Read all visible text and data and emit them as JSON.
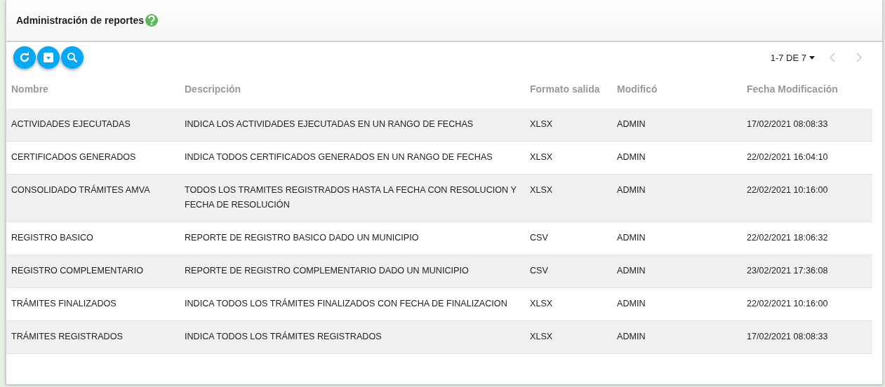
{
  "title": "Administración de reportes",
  "pagination": {
    "range": "1-7 DE 7",
    "prev_disabled": true,
    "next_disabled": true
  },
  "table": {
    "columns": [
      "Nombre",
      "Descripción",
      "Formato salida",
      "Modificó",
      "Fecha Modificación"
    ],
    "rows": [
      [
        "ACTIVIDADES EJECUTADAS",
        "INDICA LOS ACTIVIDADES EJECUTADAS EN UN RANGO DE FECHAS",
        "XLSX",
        "ADMIN",
        "17/02/2021 08:08:33"
      ],
      [
        "CERTIFICADOS GENERADOS",
        "INDICA TODOS CERTIFICADOS GENERADOS EN UN RANGO DE FECHAS",
        "XLSX",
        "ADMIN",
        "22/02/2021 16:04:10"
      ],
      [
        "CONSOLIDADO TRÁMITES AMVA",
        "TODOS LOS TRAMITES REGISTRADOS HASTA LA FECHA CON RESOLUCION Y FECHA DE RESOLUCIÓN",
        "XLSX",
        "ADMIN",
        "22/02/2021 10:16:00"
      ],
      [
        "REGISTRO BASICO",
        "REPORTE DE REGISTRO BASICO DADO UN MUNICIPIO",
        "CSV",
        "ADMIN",
        "22/02/2021 18:06:32"
      ],
      [
        "REGISTRO COMPLEMENTARIO",
        "REPORTE DE REGISTRO COMPLEMENTARIO DADO UN MUNICIPIO",
        "CSV",
        "ADMIN",
        "23/02/2021 17:36:08"
      ],
      [
        "TRÁMITES FINALIZADOS",
        "INDICA TODOS LOS TRÁMITES FINALIZADOS CON FECHA DE FINALIZACION",
        "XLSX",
        "ADMIN",
        "22/02/2021 10:16:00"
      ],
      [
        "TRÁMITES REGISTRADOS",
        "INDICA TODOS LOS TRÁMITES REGISTRADOS",
        "XLSX",
        "ADMIN",
        "17/02/2021 08:08:33"
      ]
    ]
  }
}
